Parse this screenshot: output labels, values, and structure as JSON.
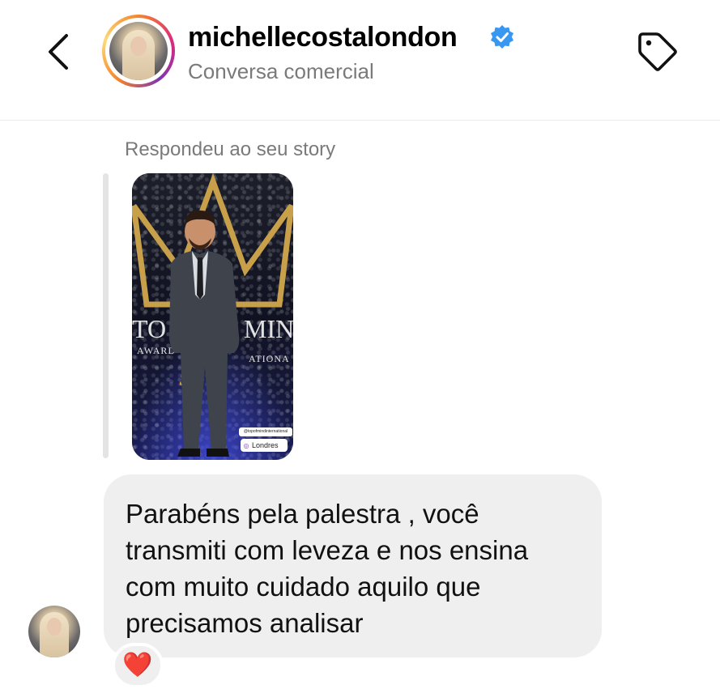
{
  "header": {
    "username": "michellecostalondon",
    "subtitle": "Conversa comercial",
    "verified": true,
    "icons": {
      "back": "chevron-left-icon",
      "label": "tag-icon",
      "verified": "verified-badge-icon"
    },
    "colors": {
      "verified": "#3897f0",
      "subtitle": "#7a7a7a"
    }
  },
  "thread": {
    "story_reply_label": "Respondeu ao seu story",
    "story": {
      "banner_left": "TO",
      "banner_right": "MIN",
      "award_line": "AWARD",
      "award_line_right": "ATIONA",
      "handle_tag": "@topofmindinternational",
      "location_tag": "Londres"
    },
    "message": {
      "lines": [
        "Parabéns pela palestra , você",
        "transmiti com leveza e nos ensina",
        "com muito cuidado aquilo que",
        "precisamos analisar"
      ],
      "bubble_color": "#efefef"
    },
    "reaction": {
      "emoji": "❤️"
    }
  }
}
